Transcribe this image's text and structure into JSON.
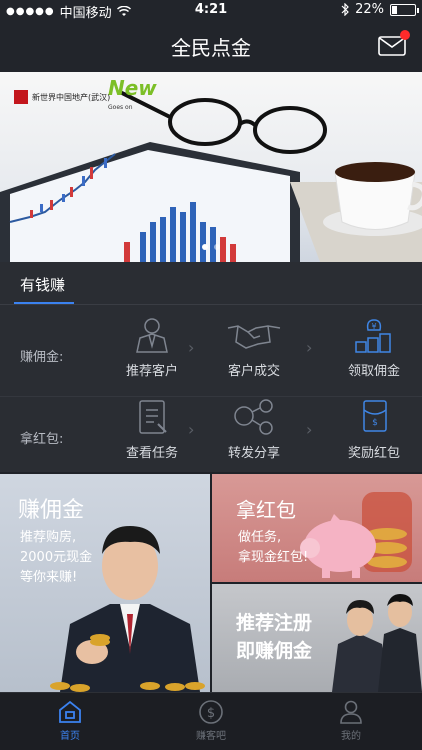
{
  "status": {
    "carrier": "中国移动",
    "time": "4:21",
    "battery": "22%",
    "battery_fraction": 0.22
  },
  "nav": {
    "title": "全民点金"
  },
  "banner": {
    "brand1": "新世界中国地产(武汉)",
    "brand2": "New",
    "brand2_sub": "Goes on"
  },
  "section": {
    "tab_label": "有钱赚"
  },
  "rows": [
    {
      "label": "赚佣金:",
      "steps": [
        "推荐客户",
        "客户成交",
        "领取佣金"
      ]
    },
    {
      "label": "拿红包:",
      "steps": [
        "查看任务",
        "转发分享",
        "奖励红包"
      ]
    }
  ],
  "promo": {
    "left": {
      "title": "赚佣金",
      "lines": [
        "推荐购房,",
        "2000元现金",
        "等你来赚!"
      ]
    },
    "right_top": {
      "title": "拿红包",
      "lines": [
        "做任务,",
        "拿现金红包!"
      ]
    },
    "right_bottom": {
      "lines": [
        "推荐注册",
        "即赚佣金"
      ]
    }
  },
  "tabs": [
    {
      "label": "首页",
      "icon": "home-icon",
      "active": true
    },
    {
      "label": "赚客吧",
      "icon": "dollar-icon",
      "active": false
    },
    {
      "label": "我的",
      "icon": "user-icon",
      "active": false
    }
  ],
  "colors": {
    "accent": "#3b82f0",
    "badge": "#ff2a2a"
  }
}
